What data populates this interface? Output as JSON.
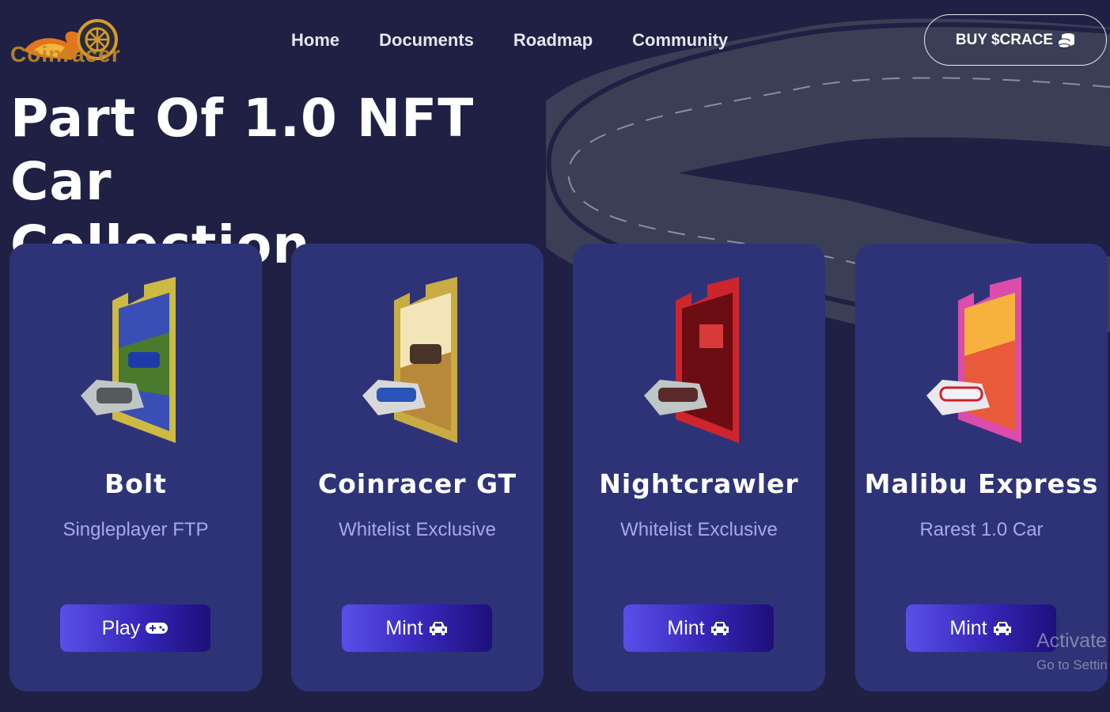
{
  "brand": {
    "name": "Coinracer"
  },
  "nav": {
    "items": [
      {
        "label": "Home"
      },
      {
        "label": "Documents"
      },
      {
        "label": "Roadmap"
      },
      {
        "label": "Community"
      }
    ],
    "buy_label": "BUY $CRACE",
    "buy_icon": "coins-icon"
  },
  "hero": {
    "title_line1": "Part Of 1.0 NFT Car",
    "title_line2": "Collection"
  },
  "cards": [
    {
      "name": "Bolt",
      "subtitle": "Singleplayer FTP",
      "button": "Play",
      "button_icon": "gamepad-icon",
      "accent": "#e8d23a"
    },
    {
      "name": "Coinracer GT",
      "subtitle": "Whitelist Exclusive",
      "button": "Mint",
      "button_icon": "car-icon",
      "accent": "#e3c23a"
    },
    {
      "name": "Nightcrawler",
      "subtitle": "Whitelist Exclusive",
      "button": "Mint",
      "button_icon": "car-icon",
      "accent": "#e02424"
    },
    {
      "name": "Malibu Express",
      "subtitle": "Rarest 1.0 Car",
      "button": "Mint",
      "button_icon": "car-icon",
      "accent": "#ee4fb0"
    }
  ],
  "watermark": {
    "line1": "Activate",
    "line2": "Go to Settin"
  },
  "colors": {
    "background": "#1f2044",
    "card": "#2e3378",
    "subtitle": "#a7a8ef",
    "button_start": "#5a4fe8",
    "button_end": "#1e0f7a"
  }
}
